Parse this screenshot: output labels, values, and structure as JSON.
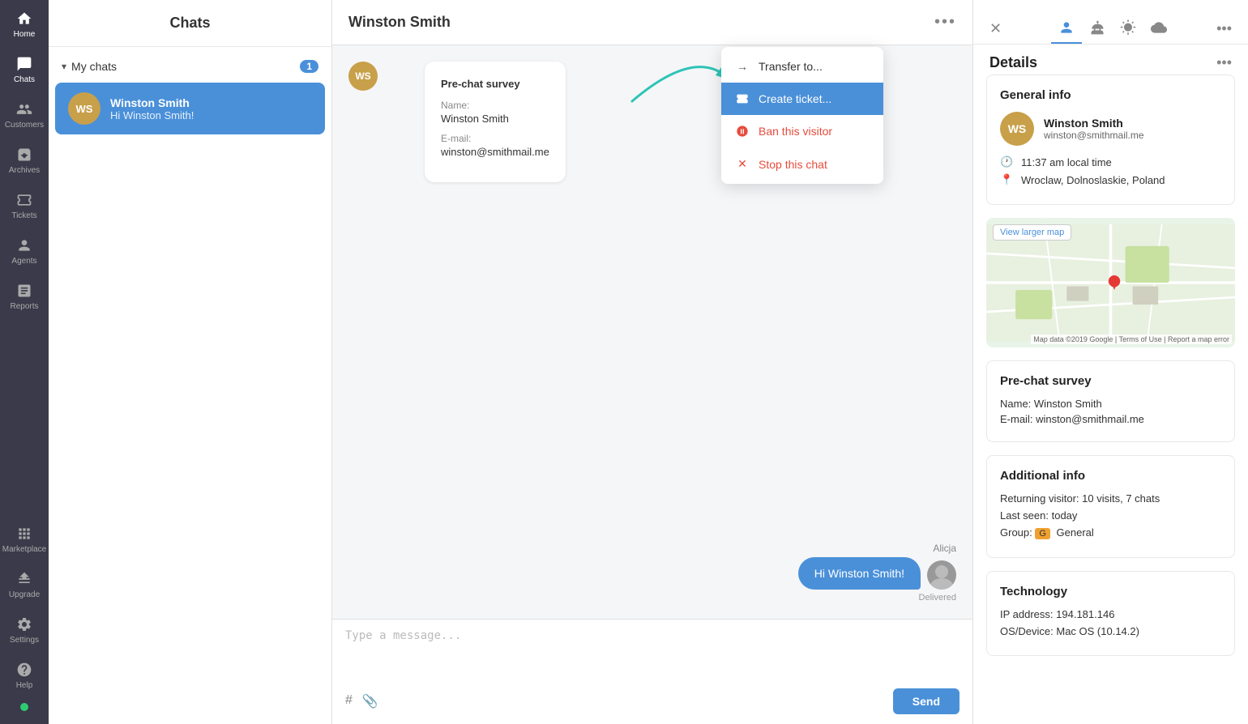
{
  "sidebar": {
    "items": [
      {
        "id": "home",
        "label": "Home",
        "icon": "home"
      },
      {
        "id": "chats",
        "label": "Chats",
        "icon": "chats",
        "active": true
      },
      {
        "id": "customers",
        "label": "Customers",
        "icon": "customers"
      },
      {
        "id": "archives",
        "label": "Archives",
        "icon": "archives"
      },
      {
        "id": "tickets",
        "label": "Tickets",
        "icon": "tickets"
      },
      {
        "id": "agents",
        "label": "Agents",
        "icon": "agents"
      },
      {
        "id": "reports",
        "label": "Reports",
        "icon": "reports"
      },
      {
        "id": "marketplace",
        "label": "Marketplace",
        "icon": "marketplace"
      },
      {
        "id": "upgrade",
        "label": "Upgrade",
        "icon": "upgrade"
      },
      {
        "id": "settings",
        "label": "Settings",
        "icon": "settings"
      },
      {
        "id": "help",
        "label": "Help",
        "icon": "help"
      }
    ]
  },
  "chat_list": {
    "title": "Chats",
    "my_chats_label": "My chats",
    "my_chats_count": "1",
    "chat_items": [
      {
        "id": "winston",
        "initials": "WS",
        "name": "Winston Smith",
        "preview": "Hi Winston Smith!"
      }
    ]
  },
  "chat_window": {
    "visitor_name": "Winston Smith",
    "pre_chat_survey": {
      "title": "Pre-chat survey",
      "name_label": "Name:",
      "name_value": "Winston Smith",
      "email_label": "E-mail:",
      "email_value": "winston@smithmail.me"
    },
    "visitor_initials": "WS",
    "agent_message": {
      "agent_name": "Alicja",
      "text": "Hi Winston Smith!",
      "status": "Delivered"
    },
    "message_placeholder": "Type a message...",
    "send_label": "Send"
  },
  "dropdown": {
    "items": [
      {
        "id": "transfer",
        "label": "Transfer to...",
        "icon": "arrow-right"
      },
      {
        "id": "ticket",
        "label": "Create ticket...",
        "icon": "ticket"
      },
      {
        "id": "ban",
        "label": "Ban this visitor",
        "icon": "ban"
      },
      {
        "id": "stop",
        "label": "Stop this chat",
        "icon": "close"
      }
    ]
  },
  "details": {
    "title": "Details",
    "tabs": [
      "person",
      "bot",
      "weather",
      "cloud"
    ],
    "general_info": {
      "section_title": "General info",
      "name": "Winston Smith",
      "email": "winston@smithmail.me",
      "local_time": "11:37 am local time",
      "location": "Wroclaw, Dolnoslaskie, Poland"
    },
    "map": {
      "view_larger": "View larger map"
    },
    "pre_chat_survey": {
      "section_title": "Pre-chat survey",
      "name_label": "Name:",
      "name_value": "Winston Smith",
      "email_label": "E-mail:",
      "email_value": "winston@smithmail.me"
    },
    "additional_info": {
      "section_title": "Additional info",
      "returning_label": "Returning visitor:",
      "returning_value": "10 visits, 7 chats",
      "last_seen_label": "Last seen:",
      "last_seen_value": "today",
      "group_label": "Group:",
      "group_value": "General"
    },
    "technology": {
      "section_title": "Technology",
      "ip_label": "IP address:",
      "ip_value": "194.181.146",
      "os_label": "OS/Device:",
      "os_value": "Mac OS (10.14.2)"
    }
  }
}
